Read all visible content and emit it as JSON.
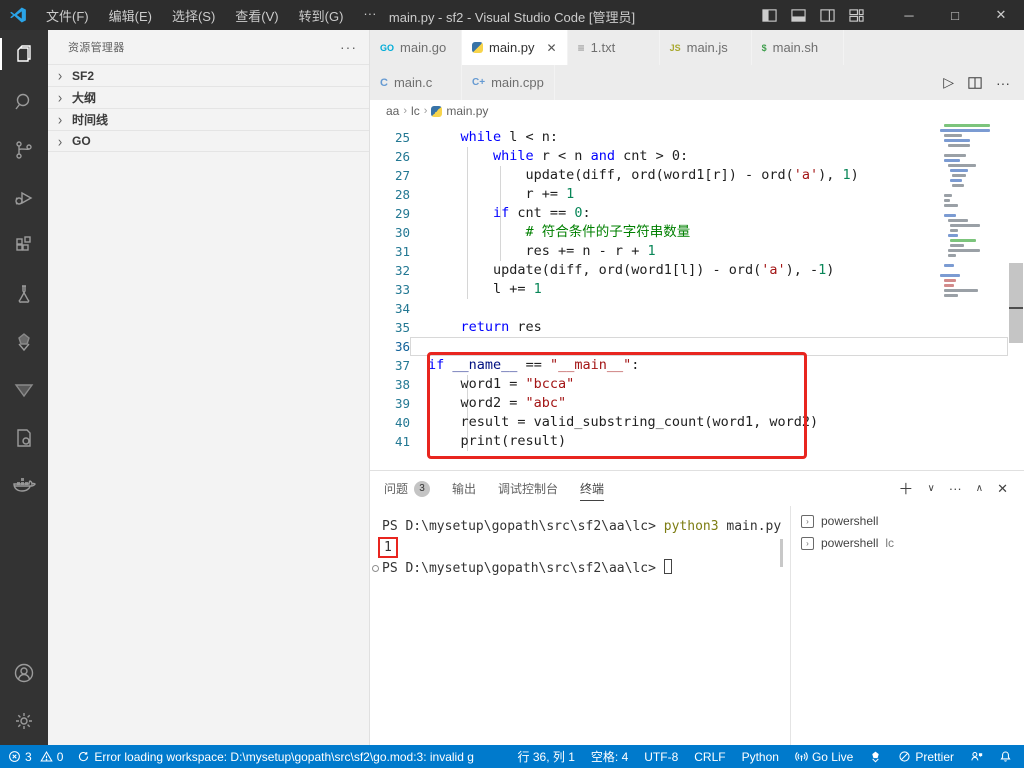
{
  "titlebar": {
    "menus": [
      "文件(F)",
      "编辑(E)",
      "选择(S)",
      "查看(V)",
      "转到(G)",
      "···"
    ],
    "title": "main.py - sf2 - Visual Studio Code [管理员]"
  },
  "activity_bar": {
    "items": [
      "explorer",
      "search",
      "source-control",
      "run-debug",
      "extensions",
      "testing",
      "go-tools",
      "triangle-tool",
      "project-file",
      "docker",
      "account",
      "settings"
    ]
  },
  "sidebar": {
    "header": "资源管理器",
    "more": "···",
    "sections": [
      "SF2",
      "大纲",
      "时间线",
      "GO"
    ]
  },
  "editor": {
    "tabs_row1": [
      {
        "label": "main.go",
        "icon": "go"
      },
      {
        "label": "main.py",
        "icon": "python",
        "active": true
      },
      {
        "label": "1.txt",
        "icon": "txt"
      },
      {
        "label": "main.js",
        "icon": "js"
      },
      {
        "label": "main.sh",
        "icon": "sh"
      }
    ],
    "tabs_row2": [
      {
        "label": "main.c",
        "icon": "c"
      },
      {
        "label": "main.cpp",
        "icon": "cpp"
      }
    ],
    "breadcrumb": [
      "aa",
      "lc",
      "main.py"
    ],
    "code_lines": [
      {
        "n": "25",
        "tokens": [
          [
            "d",
            "    "
          ],
          [
            "kw",
            "while"
          ],
          [
            "d",
            " l < n:"
          ]
        ]
      },
      {
        "n": "26",
        "tokens": [
          [
            "d",
            "        "
          ],
          [
            "kw",
            "while"
          ],
          [
            "d",
            " r < n "
          ],
          [
            "kw",
            "and"
          ],
          [
            "d",
            " cnt > 0:"
          ]
        ]
      },
      {
        "n": "27",
        "tokens": [
          [
            "d",
            "            update(diff, ord(word1[r]) - ord("
          ],
          [
            "str",
            "'a'"
          ],
          [
            "d",
            "), "
          ],
          [
            "num",
            "1"
          ],
          [
            "d",
            ")"
          ]
        ]
      },
      {
        "n": "28",
        "tokens": [
          [
            "d",
            "            r += "
          ],
          [
            "num",
            "1"
          ]
        ]
      },
      {
        "n": "29",
        "tokens": [
          [
            "d",
            "        "
          ],
          [
            "kw",
            "if"
          ],
          [
            "d",
            " cnt == "
          ],
          [
            "num",
            "0"
          ],
          [
            "d",
            ":"
          ]
        ]
      },
      {
        "n": "30",
        "tokens": [
          [
            "d",
            "            "
          ],
          [
            "com",
            "# 符合条件的子字符串数量"
          ]
        ]
      },
      {
        "n": "31",
        "tokens": [
          [
            "d",
            "            res += n - r + "
          ],
          [
            "num",
            "1"
          ]
        ]
      },
      {
        "n": "32",
        "tokens": [
          [
            "d",
            "        update(diff, ord(word1[l]) - ord("
          ],
          [
            "str",
            "'a'"
          ],
          [
            "d",
            "), -"
          ],
          [
            "num",
            "1"
          ],
          [
            "d",
            ")"
          ]
        ]
      },
      {
        "n": "33",
        "tokens": [
          [
            "d",
            "        l += "
          ],
          [
            "num",
            "1"
          ]
        ]
      },
      {
        "n": "34",
        "tokens": []
      },
      {
        "n": "35",
        "tokens": [
          [
            "d",
            "    "
          ],
          [
            "kw",
            "return"
          ],
          [
            "d",
            " res"
          ]
        ]
      },
      {
        "n": "36",
        "tokens": [],
        "current": true
      },
      {
        "n": "37",
        "tokens": [
          [
            "kw",
            "if"
          ],
          [
            "d",
            " "
          ],
          [
            "var",
            "__name__"
          ],
          [
            "d",
            " == "
          ],
          [
            "str",
            "\"__main__\""
          ],
          [
            "d",
            ":"
          ]
        ]
      },
      {
        "n": "38",
        "tokens": [
          [
            "d",
            "    word1 = "
          ],
          [
            "str",
            "\"bcca\""
          ]
        ]
      },
      {
        "n": "39",
        "tokens": [
          [
            "d",
            "    word2 = "
          ],
          [
            "str",
            "\"abc\""
          ]
        ]
      },
      {
        "n": "40",
        "tokens": [
          [
            "d",
            "    result = valid_substring_count(word1, word2)"
          ]
        ]
      },
      {
        "n": "41",
        "tokens": [
          [
            "d",
            "    print(result)"
          ]
        ]
      }
    ],
    "minimap_rows": [
      [
        4,
        46,
        "g"
      ],
      [
        0,
        50,
        "b"
      ],
      [
        4,
        18,
        "d"
      ],
      [
        4,
        26,
        "b"
      ],
      [
        8,
        22,
        "d"
      ],
      [
        0,
        0,
        "d"
      ],
      [
        4,
        22,
        "d"
      ],
      [
        4,
        16,
        "b"
      ],
      [
        8,
        28,
        "d"
      ],
      [
        10,
        18,
        "b"
      ],
      [
        12,
        14,
        "d"
      ],
      [
        10,
        12,
        "b"
      ],
      [
        12,
        12,
        "d"
      ],
      [
        0,
        0,
        "d"
      ],
      [
        4,
        8,
        "d"
      ],
      [
        4,
        6,
        "d"
      ],
      [
        4,
        14,
        "d"
      ],
      [
        0,
        0,
        "d"
      ],
      [
        4,
        12,
        "b"
      ],
      [
        8,
        20,
        "d"
      ],
      [
        10,
        30,
        "d"
      ],
      [
        10,
        8,
        "d"
      ],
      [
        8,
        10,
        "b"
      ],
      [
        10,
        26,
        "g"
      ],
      [
        10,
        14,
        "d"
      ],
      [
        8,
        32,
        "d"
      ],
      [
        8,
        8,
        "d"
      ],
      [
        0,
        0,
        "d"
      ],
      [
        4,
        10,
        "b"
      ],
      [
        0,
        0,
        "d"
      ],
      [
        0,
        20,
        "b"
      ],
      [
        4,
        12,
        "r"
      ],
      [
        4,
        10,
        "r"
      ],
      [
        4,
        34,
        "d"
      ],
      [
        4,
        14,
        "d"
      ]
    ]
  },
  "panel": {
    "tabs": [
      {
        "label": "问题",
        "badge": "3"
      },
      {
        "label": "输出"
      },
      {
        "label": "调试控制台"
      },
      {
        "label": "终端",
        "active": true
      }
    ],
    "terminal": {
      "lines": [
        {
          "segments": [
            [
              "d",
              "PS D:\\mysetup\\gopath\\src\\sf2\\aa\\lc> "
            ],
            [
              "cmd",
              "python3"
            ],
            [
              "d",
              " main.py"
            ]
          ]
        },
        {
          "boxed": true,
          "segments": [
            [
              "d",
              "1"
            ]
          ]
        },
        {
          "decoration": true,
          "cursor": true,
          "segments": [
            [
              "d",
              "PS D:\\mysetup\\gopath\\src\\sf2\\aa\\lc> "
            ]
          ]
        }
      ],
      "list": [
        {
          "label": "powershell",
          "desc": ""
        },
        {
          "label": "powershell",
          "desc": "lc"
        }
      ]
    }
  },
  "statusbar": {
    "errors": "3",
    "warnings": "0",
    "message": "Error loading workspace: D:\\mysetup\\gopath\\src\\sf2\\go.mod:3: invalid g",
    "right_items": [
      {
        "name": "cursor-position",
        "label": "行 36, 列 1"
      },
      {
        "name": "indentation",
        "label": "空格: 4"
      },
      {
        "name": "encoding",
        "label": "UTF-8"
      },
      {
        "name": "eol",
        "label": "CRLF"
      },
      {
        "name": "language-mode",
        "label": "Python"
      },
      {
        "name": "go-live",
        "icon": "broadcast",
        "label": "Go Live"
      },
      {
        "name": "extension-logo",
        "icon": "pinwheel",
        "label": ""
      },
      {
        "name": "prettier",
        "icon": "slash",
        "label": "Prettier"
      },
      {
        "name": "feedback",
        "icon": "feedback",
        "label": ""
      },
      {
        "name": "notifications",
        "icon": "bell",
        "label": ""
      }
    ]
  }
}
